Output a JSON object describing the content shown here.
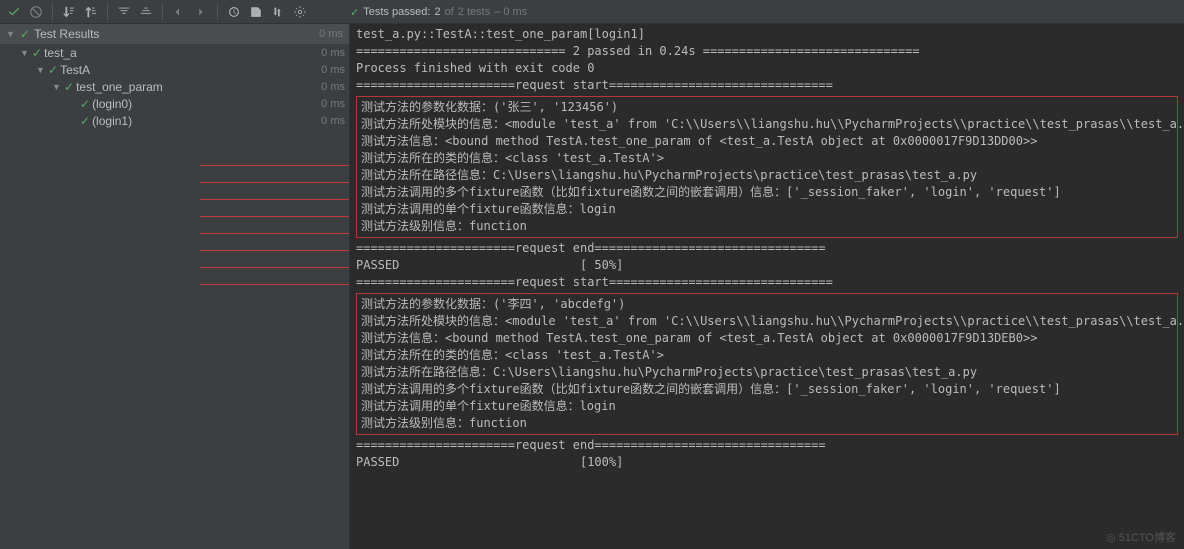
{
  "toolbar": {
    "icons": [
      "check",
      "stop",
      "sort-down",
      "sort-up",
      "expand",
      "collapse",
      "prev",
      "next",
      "history",
      "export",
      "import-export",
      "settings"
    ]
  },
  "status": {
    "icon": "✓",
    "prefix": "Tests passed:",
    "count": "2",
    "mid": "of",
    "total": "2 tests",
    "suffix": "– 0 ms"
  },
  "tree": {
    "header": {
      "icon": "✓",
      "label": "Test Results",
      "time": "0 ms"
    },
    "rows": [
      {
        "indent": 1,
        "arrow": "▼",
        "icon": "✓",
        "label": "test_a",
        "time": "0 ms"
      },
      {
        "indent": 2,
        "arrow": "▼",
        "icon": "✓",
        "label": "TestA",
        "time": "0 ms"
      },
      {
        "indent": 3,
        "arrow": "▼",
        "icon": "✓",
        "label": "test_one_param",
        "time": "0 ms"
      },
      {
        "indent": 4,
        "arrow": "",
        "icon": "✓",
        "label": "(login0)",
        "time": "0 ms"
      },
      {
        "indent": 4,
        "arrow": "",
        "icon": "✓",
        "label": "(login1)",
        "time": "0 ms"
      }
    ]
  },
  "console": {
    "l1": "test_a.py::TestA::test_one_param[login1]",
    "l2": "",
    "l3": "============================= 2 passed in 0.24s ==============================",
    "l4": "",
    "l5": "Process finished with exit code 0",
    "l6": "",
    "l7": "======================request start===============================",
    "b1_1": "测试方法的参数化数据：('张三', '123456')",
    "b1_2": "测试方法所处模块的信息：<module 'test_a' from 'C:\\\\Users\\\\liangshu.hu\\\\PycharmProjects\\\\practice\\\\test_prasas\\\\test_a.py'>",
    "b1_3": "测试方法信息：<bound method TestA.test_one_param of <test_a.TestA object at 0x0000017F9D13DD00>>",
    "b1_4": "测试方法所在的类的信息：<class 'test_a.TestA'>",
    "b1_5": "测试方法所在路径信息：C:\\Users\\liangshu.hu\\PycharmProjects\\practice\\test_prasas\\test_a.py",
    "b1_6": "测试方法调用的多个fixture函数（比如fixture函数之间的嵌套调用）信息：['_session_faker', 'login', 'request']",
    "b1_7": "测试方法调用的单个fixture函数信息：login",
    "b1_8": "测试方法级别信息：function",
    "l8": "",
    "l9": "======================request end================================",
    "l10": "PASSED                         [ 50%]",
    "l11": "======================request start===============================",
    "b2_1": "测试方法的参数化数据：('李四', 'abcdefg')",
    "b2_2": "测试方法所处模块的信息：<module 'test_a' from 'C:\\\\Users\\\\liangshu.hu\\\\PycharmProjects\\\\practice\\\\test_prasas\\\\test_a.py'>",
    "b2_3": "测试方法信息：<bound method TestA.test_one_param of <test_a.TestA object at 0x0000017F9D13DEB0>>",
    "b2_4": "测试方法所在的类的信息：<class 'test_a.TestA'>",
    "b2_5": "测试方法所在路径信息：C:\\Users\\liangshu.hu\\PycharmProjects\\practice\\test_prasas\\test_a.py",
    "b2_6": "测试方法调用的多个fixture函数（比如fixture函数之间的嵌套调用）信息：['_session_faker', 'login', 'request']",
    "b2_7": "测试方法调用的单个fixture函数信息：login",
    "b2_8": "测试方法级别信息：function",
    "l12": "",
    "l13": "======================request end================================",
    "l14": "PASSED                         [100%]"
  },
  "watermark": "◎ 51CTO博客"
}
